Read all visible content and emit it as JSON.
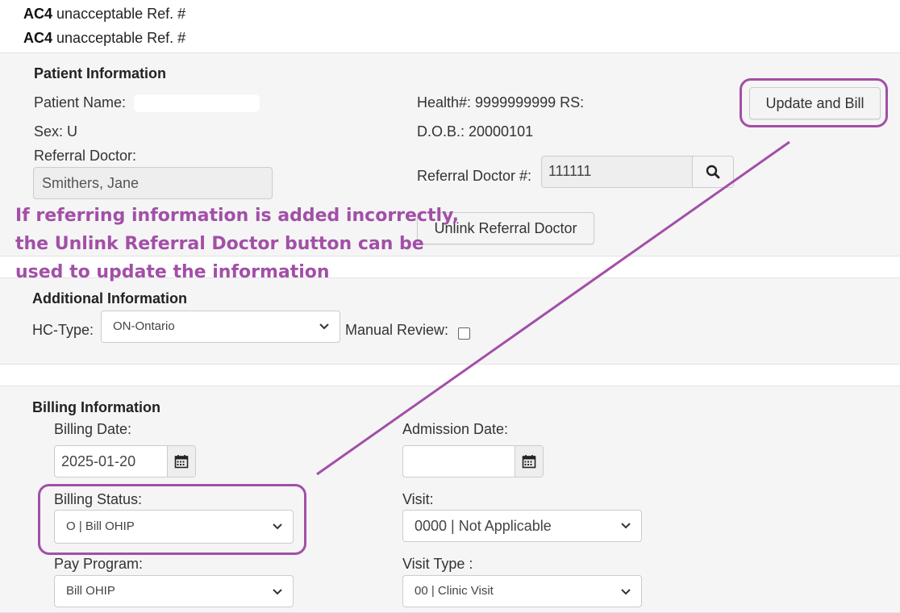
{
  "errors": [
    {
      "code": "AC4",
      "message": "unacceptable Ref. #"
    },
    {
      "code": "AC4",
      "message": "unacceptable Ref. #"
    }
  ],
  "patient_info": {
    "heading": "Patient Information",
    "name_label": "Patient Name:",
    "health_label": "Health#: 9999999999 RS:",
    "sex": "Sex: U",
    "dob": "D.O.B.: 20000101",
    "referral_doctor_label": "Referral Doctor:",
    "referral_doctor_value": "Smithers, Jane",
    "referral_doctor_num_label": "Referral Doctor #:",
    "referral_doctor_num_value": "111111",
    "update_bill_button": "Update and Bill",
    "unlink_button": "Unlink Referral Doctor"
  },
  "annotation": {
    "line1": "If referring information is added incorrectly,",
    "line2": "the Unlink Referral Doctor button can be",
    "line3": "used to update the information",
    "color": "#a24fa7"
  },
  "additional_info": {
    "heading": "Additional Information",
    "hc_type_label": "HC-Type:",
    "hc_type_value": "ON-Ontario",
    "manual_review_label": "Manual Review:"
  },
  "billing_info": {
    "heading": "Billing Information",
    "billing_date_label": "Billing Date:",
    "billing_date_value": "2025-01-20",
    "admission_date_label": "Admission Date:",
    "admission_date_value": "",
    "billing_status_label": "Billing Status:",
    "billing_status_value": "O | Bill OHIP",
    "visit_label": "Visit:",
    "visit_value": "0000 | Not Applicable",
    "pay_program_label": "Pay Program:",
    "pay_program_value": "Bill OHIP",
    "visit_type_label": "Visit Type :",
    "visit_type_value": "00 | Clinic Visit"
  }
}
